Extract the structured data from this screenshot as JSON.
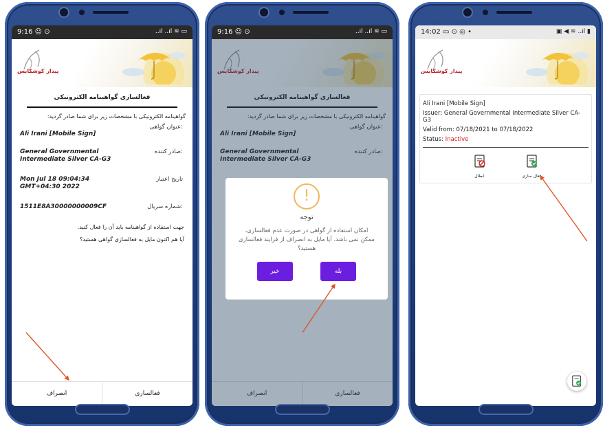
{
  "phones": [
    {
      "status": {
        "time": "9:16 ☺ ⊙",
        "icons": "..ıl ..ıl ≋ ▭"
      },
      "logo_text": "پیدار کوشکایس",
      "title": "فعالسازی گواهینامه الکترونیکی",
      "intro": "گواهینامه الکترونیکی با مشخصات زیر برای شما صادر گردید:",
      "fields": [
        {
          "label": "عنوان گواهی:",
          "value": "Ali Irani [Mobile Sign]"
        },
        {
          "label": "صادر کننده:",
          "value": "General Governmental Intermediate Silver CA-G3"
        },
        {
          "label": "تاریخ اعتبار",
          "value": "Mon Jul 18 09:04:34 GMT+04:30 2022"
        },
        {
          "label": "شماره سریال:",
          "value": "1511E8A30000000009CF"
        }
      ],
      "note": "جهت استفاده از گواهینامه باید آن را فعال کنید.",
      "question": "آیا هم اکنون مایل به فعالسازی گواهی هستید؟",
      "footer": {
        "cancel": "انصراف",
        "activate": "فعالسازی"
      }
    },
    {
      "status": {
        "time": "9:16 ☺ ⊙",
        "icons": "..ıl ..ıl ≋ ▭"
      },
      "logo_text": "پیدار کوشکایس",
      "title": "فعالسازی گواهینامه الکترونیکی",
      "intro": "گواهینامه الکترونیکی با مشخصات زیر برای شما صادر گردید:",
      "fields": [
        {
          "label": "عنوان گواهی:",
          "value": "Ali Irani [Mobile Sign]"
        },
        {
          "label": "صادر کننده:",
          "value": "General Governmental Intermediate Silver CA-G3"
        }
      ],
      "dialog": {
        "title": "توجه",
        "message": "امکان استفاده از گواهی در صورت عدم فعالسازی، ممکن نمی باشد. آیا مایل به انصراف از فرایند فعالسازی هستید؟",
        "no": "خیر",
        "yes": "بله"
      },
      "footer": {
        "cancel": "انصراف",
        "activate": "فعالسازی"
      }
    },
    {
      "status": {
        "time": "14:02 ▭ ⊙ ◎ •",
        "icons": "▣ ◀ ≋ ..ıl ▮"
      },
      "logo_text": "پیدار کوشکایس",
      "card": {
        "name": "Ali Irani [Mobile Sign]",
        "issuer": "Issuer: General Governmental Intermediate Silver CA-G3",
        "valid": "Valid from: 07/18/2021 to 07/18/2022",
        "status_label": "Status:",
        "status_value": "Inactive"
      },
      "actions": {
        "revoke": "ابطال",
        "activate": "فعال سازی"
      }
    }
  ],
  "colors": {
    "accent": "#6c1ee0",
    "inactive": "#d81b1b",
    "arrow": "#e0552a",
    "warning": "#f2b65a"
  },
  "icons": [
    "warning-icon",
    "revoke-icon",
    "activate-icon",
    "fab-certificate-icon",
    "logo-icon",
    "sun-umbrella-icon"
  ]
}
